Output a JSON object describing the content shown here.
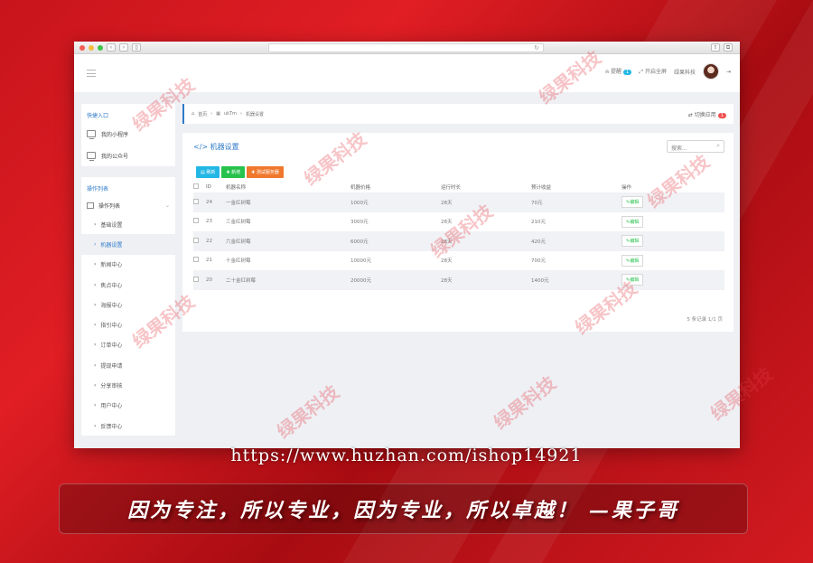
{
  "browser": {},
  "topbar": {
    "notice_label": "提醒",
    "notice_count": "1",
    "fullscreen_label": "开启全屏",
    "company_label": "绿果科技"
  },
  "sidebar": {
    "quick_title": "快捷入口",
    "quick_items": [
      {
        "label": "我的小程序"
      },
      {
        "label": "我的公众号"
      }
    ],
    "op_title": "操作列表",
    "op_group": "操作列表",
    "items": [
      {
        "label": "基础设置"
      },
      {
        "label": "机器设置"
      },
      {
        "label": "新闻中心"
      },
      {
        "label": "焦点中心"
      },
      {
        "label": "海报中心"
      },
      {
        "label": "指引中心"
      },
      {
        "label": "订单中心"
      },
      {
        "label": "提现申请"
      },
      {
        "label": "分享审核"
      },
      {
        "label": "用户中心"
      },
      {
        "label": "反馈中心"
      }
    ]
  },
  "breadcrumb": {
    "home": "首页",
    "middle": "ukTm",
    "current": "机器设置",
    "switch_label": "切换应用",
    "switch_count": "1"
  },
  "panel": {
    "title": "机器设置",
    "search_placeholder": "搜索...",
    "buttons": {
      "refresh": "刷新",
      "add": "新增",
      "test": "测试服务器"
    },
    "columns": [
      "ID",
      "机器名称",
      "机器价格",
      "运行时长",
      "预计收益",
      "操作"
    ],
    "rows": [
      {
        "id": "24",
        "name": "一金红树莓",
        "price": "1000元",
        "duration": "28天",
        "income": "70元",
        "action": "编辑"
      },
      {
        "id": "23",
        "name": "三金红树莓",
        "price": "3000元",
        "duration": "28天",
        "income": "210元",
        "action": "编辑"
      },
      {
        "id": "22",
        "name": "六金红树莓",
        "price": "6000元",
        "duration": "28天",
        "income": "420元",
        "action": "编辑"
      },
      {
        "id": "21",
        "name": "十金红树莓",
        "price": "10000元",
        "duration": "28天",
        "income": "700元",
        "action": "编辑"
      },
      {
        "id": "20",
        "name": "二十金红树莓",
        "price": "20000元",
        "duration": "28天",
        "income": "1400元",
        "action": "编辑"
      }
    ],
    "pager": "5 条记录 1/1 页"
  },
  "footer": {
    "url": "https://www.huzhan.com/ishop14921",
    "slogan": "因为专注，所以专业，因为专业，所以卓越！ —果子哥"
  },
  "watermark": {
    "text": "绿果科技"
  },
  "colors": {
    "accent": "#2e7ac8",
    "btn_refresh": "#23b7e5",
    "btn_add": "#27c24c",
    "btn_test": "#f0782d",
    "background_red": "#c8141c"
  }
}
